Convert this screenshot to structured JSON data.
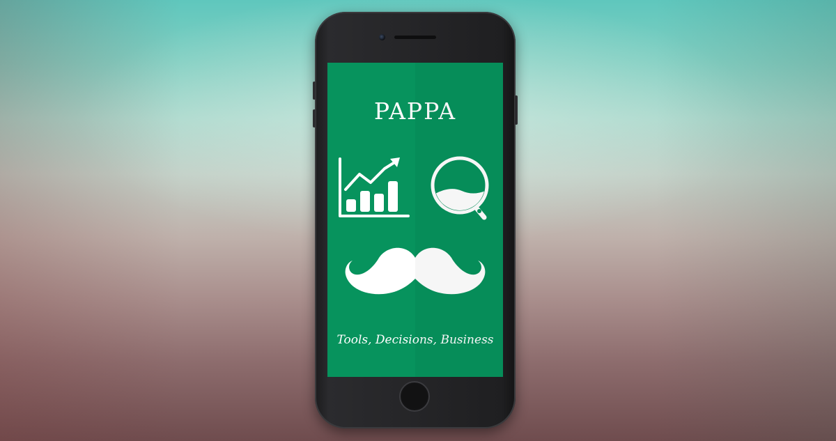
{
  "app": {
    "title": "PAPPA",
    "tagline": "Tools, Decisions, Business"
  },
  "icons": {
    "growth_chart": "bar-chart-growth-icon",
    "search": "magnifier-icon",
    "mustache": "mustache-icon"
  },
  "colors": {
    "screen_background": "#07935d",
    "icon_foreground": "#ffffff",
    "device_body": "#1f1f21"
  }
}
